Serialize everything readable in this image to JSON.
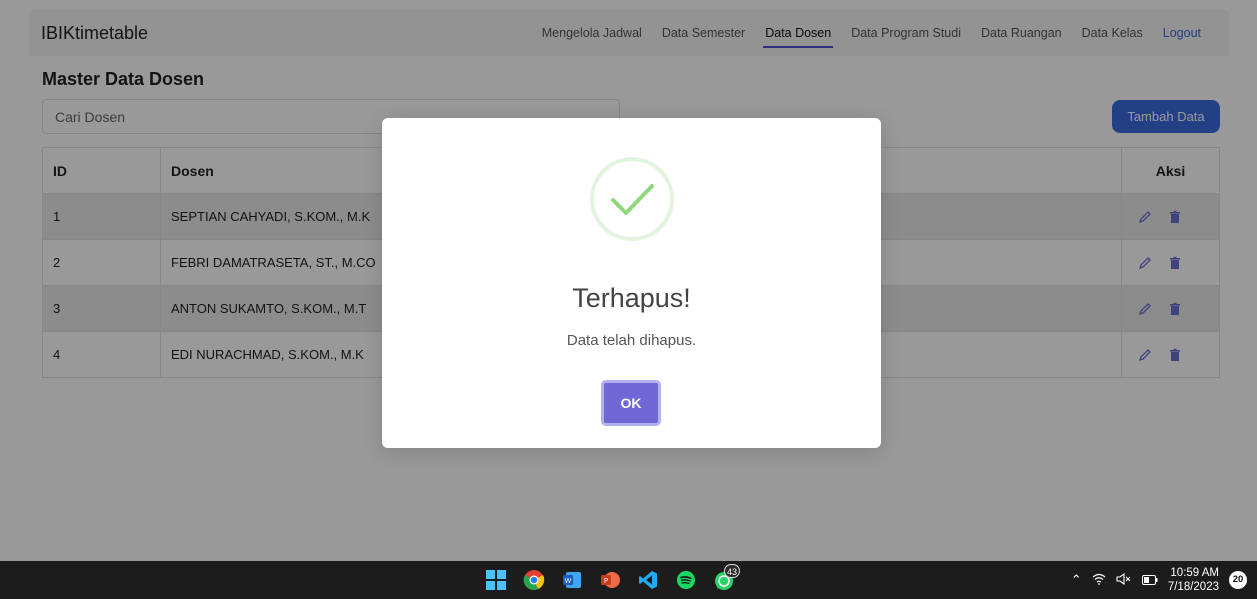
{
  "app": {
    "brand": "IBIKtimetable"
  },
  "nav": {
    "items": [
      {
        "label": "Mengelola Jadwal",
        "active": false
      },
      {
        "label": "Data Semester",
        "active": false
      },
      {
        "label": "Data Dosen",
        "active": true
      },
      {
        "label": "Data Program Studi",
        "active": false
      },
      {
        "label": "Data Ruangan",
        "active": false
      },
      {
        "label": "Data Kelas",
        "active": false
      }
    ],
    "logout": "Logout"
  },
  "page": {
    "title": "Master Data Dosen",
    "search_placeholder": "Cari Dosen",
    "add_button": "Tambah Data"
  },
  "table": {
    "headers": {
      "id": "ID",
      "name": "Dosen",
      "action": "Aksi"
    },
    "rows": [
      {
        "id": "1",
        "name": "SEPTIAN CAHYADI, S.KOM., M.K"
      },
      {
        "id": "2",
        "name": "FEBRI DAMATRASETA, ST., M.CO"
      },
      {
        "id": "3",
        "name": "ANTON SUKAMTO, S.KOM., M.T"
      },
      {
        "id": "4",
        "name": "EDI NURACHMAD, S.KOM., M.K"
      }
    ],
    "row_actions": [
      "edit-pencil-icon",
      "delete-trash-icon"
    ]
  },
  "modal": {
    "icon": "success-check-icon",
    "title": "Terhapus!",
    "text": "Data telah dihapus.",
    "ok_label": "OK"
  },
  "taskbar": {
    "apps": [
      {
        "name": "windows-start-icon"
      },
      {
        "name": "chrome-icon"
      },
      {
        "name": "word-icon"
      },
      {
        "name": "powerpoint-icon"
      },
      {
        "name": "vscode-icon"
      },
      {
        "name": "spotify-icon"
      },
      {
        "name": "whatsapp-icon",
        "badge": "43"
      }
    ],
    "time": "10:59 AM",
    "date": "7/18/2023",
    "notifications": "20"
  },
  "colors": {
    "nav_active_underline": "#4b53d8",
    "logout": "#3b6bd6",
    "add_button": "#3b6be0",
    "ok_button": "#7166d6",
    "success": "#8fd67d",
    "action_icon": "#6b6fd0"
  }
}
